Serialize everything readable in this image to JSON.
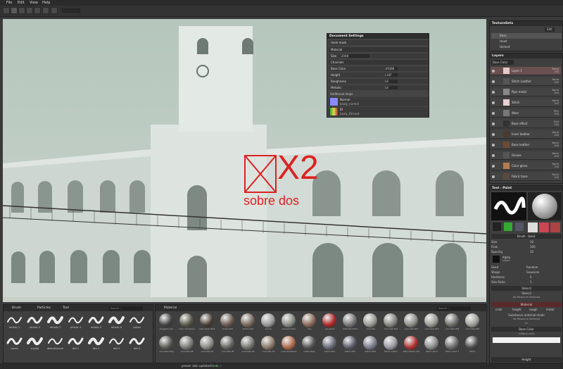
{
  "menu": [
    "File",
    "Edit",
    "View",
    "Help"
  ],
  "texture_sets": {
    "title": "TextureSets",
    "btn_edit": "Edit",
    "items": [
      "Base",
      "Head",
      "Helmet"
    ]
  },
  "document_settings": {
    "title": "Document Settings",
    "uv_mode": "Uvde mask",
    "material_label": "Material",
    "size_label": "Size",
    "size_value": "2048",
    "channels_label": "Channels",
    "channels": [
      {
        "label": "Base Color",
        "value": "sRGB8"
      },
      {
        "label": "Height",
        "value": "L16F"
      },
      {
        "label": "Roughness",
        "value": "L8"
      },
      {
        "label": "Metallic",
        "value": "L8"
      }
    ],
    "additional_maps_label": "Additional maps",
    "maps": [
      {
        "name": "Normal",
        "sub": "baaly_normal"
      },
      {
        "name": "ID",
        "sub": "baaly_IDmask"
      }
    ]
  },
  "layers": {
    "title": "Layers",
    "channel_select": "Base Color",
    "items": [
      {
        "name": "Layer 1",
        "blend": "Norm\n100",
        "thumb": "#e8c8c8"
      },
      {
        "name": "Stitch Leather",
        "blend": "Norm\n100",
        "thumb": "#555"
      },
      {
        "name": "Pipe metal",
        "blend": "Norm\n100",
        "thumb": "#888"
      },
      {
        "name": "Stitch",
        "blend": "Norm\n100",
        "thumb": "#e8d0d0"
      },
      {
        "name": "Wear",
        "blend": "Pthr\n100",
        "thumb": "#777"
      },
      {
        "name": "Base effect",
        "blend": "Ovrl\n100",
        "thumb": "#333"
      },
      {
        "name": "Inner leather",
        "blend": "Norm\n100",
        "thumb": "#4a3a30"
      },
      {
        "name": "Base leather",
        "blend": "Norm\n100",
        "thumb": "#6b4a34"
      },
      {
        "name": "Gloves",
        "blend": "Norm\n100",
        "thumb": "#555"
      },
      {
        "name": "Color glove",
        "blend": "Norm\n100",
        "thumb": "#b77a4e"
      },
      {
        "name": "Fabric base",
        "blend": "Norm\n100",
        "thumb": "#5a4a40"
      }
    ]
  },
  "tool_panel": {
    "title": "Tool - Paint",
    "brush_section": "Brush - basic",
    "params": [
      {
        "label": "Size",
        "value": "10"
      },
      {
        "label": "Flow",
        "value": "100"
      },
      {
        "label": "Spacing",
        "value": "10"
      }
    ],
    "alpha_label": "Alpha",
    "alpha_sub": "shape",
    "seed_label": "Seed",
    "seed_value": "Random",
    "shape_label": "Shape",
    "shape_value": "Gaussian",
    "hardness_label": "Hardness",
    "hardness_value": "0",
    "size_ratio_label": "Size Ratio",
    "size_ratio_value": "1",
    "stencil_head": "Stencil",
    "stencil_sub": "Stencil",
    "stencil_none": "No Resource Selected",
    "material_head": "Material",
    "mat_tabs": [
      "color",
      "height",
      "rough",
      "metal"
    ],
    "substance_label": "Substance material mode",
    "substance_none": "No Resource Selected",
    "or_label": "Or",
    "base_color_head": "Base Color",
    "base_color_sub": "uniform color",
    "height_head": "Height"
  },
  "shelf": {
    "tabs": [
      "Brush",
      "Particles",
      "Tool"
    ],
    "search": "Search ...",
    "brushes": [
      "artistic 1",
      "artistic 2",
      "artistic 3",
      "artistic 4",
      "artistic 5",
      "artistic 6",
      "cotton",
      "cracks",
      "crystal",
      "default brush",
      "dirt 1",
      "dirt 2",
      "dirt 3",
      "dirt 5"
    ],
    "material_tab": "Material",
    "materials": [
      {
        "name": "bagged-coal",
        "color": "#444"
      },
      {
        "name": "bark-old-green",
        "color": "#5a5a4a"
      },
      {
        "name": "bark-pine-dark",
        "color": "#4a3e36"
      },
      {
        "name": "bricks 001",
        "color": "#6a5a52"
      },
      {
        "name": "bricks 003",
        "color": "#7a6a5e"
      },
      {
        "name": "bump",
        "color": "#999"
      },
      {
        "name": "cement-basic",
        "color": "#8a8a84"
      },
      {
        "name": "clay",
        "color": "#8a6a5a"
      },
      {
        "name": "car-paint",
        "color": "#b02828"
      },
      {
        "name": "Castrated 001",
        "color": "#777"
      },
      {
        "name": "concrete",
        "color": "#9a9a94"
      },
      {
        "name": "concrete 001",
        "color": "#858580"
      },
      {
        "name": "concrete 002",
        "color": "#8e8e88"
      },
      {
        "name": "concrete 003",
        "color": "#999993"
      },
      {
        "name": "concrete 004",
        "color": "#6e6e6a"
      },
      {
        "name": "concrete 005",
        "color": "#a0a09a"
      },
      {
        "name": "concrete-dirty",
        "color": "#5a5a56"
      },
      {
        "name": "concrete 06",
        "color": "#7a7a76"
      },
      {
        "name": "concrete 07",
        "color": "#8a8a86"
      },
      {
        "name": "concrete 08",
        "color": "#666662"
      },
      {
        "name": "concrete 09",
        "color": "#777772"
      },
      {
        "name": "concrete 10",
        "color": "#8a7a6a"
      },
      {
        "name": "color-andaman",
        "color": "#b06a4a"
      },
      {
        "name": "crate steel",
        "color": "#555"
      },
      {
        "name": "fabric 002",
        "color": "#6a6a7a"
      },
      {
        "name": "fabric 003",
        "color": "#5a5a6a"
      },
      {
        "name": "fabric 004",
        "color": "#7a7a8a"
      },
      {
        "name": "fabric-cotton",
        "color": "#9a9aa2"
      },
      {
        "name": "fabric-flaxe-mix",
        "color": "#b03030"
      },
      {
        "name": "fabric-wool",
        "color": "#8a8a8a"
      },
      {
        "name": "fabric wool 2",
        "color": "#6a6a6a"
      },
      {
        "name": "fabric",
        "color": "#4a4a4a"
      }
    ]
  },
  "status": {
    "text": "preset: akin updated",
    "sub": "Undo ☆"
  },
  "watermark": {
    "line1": "X2",
    "line2": "sobre dos"
  }
}
